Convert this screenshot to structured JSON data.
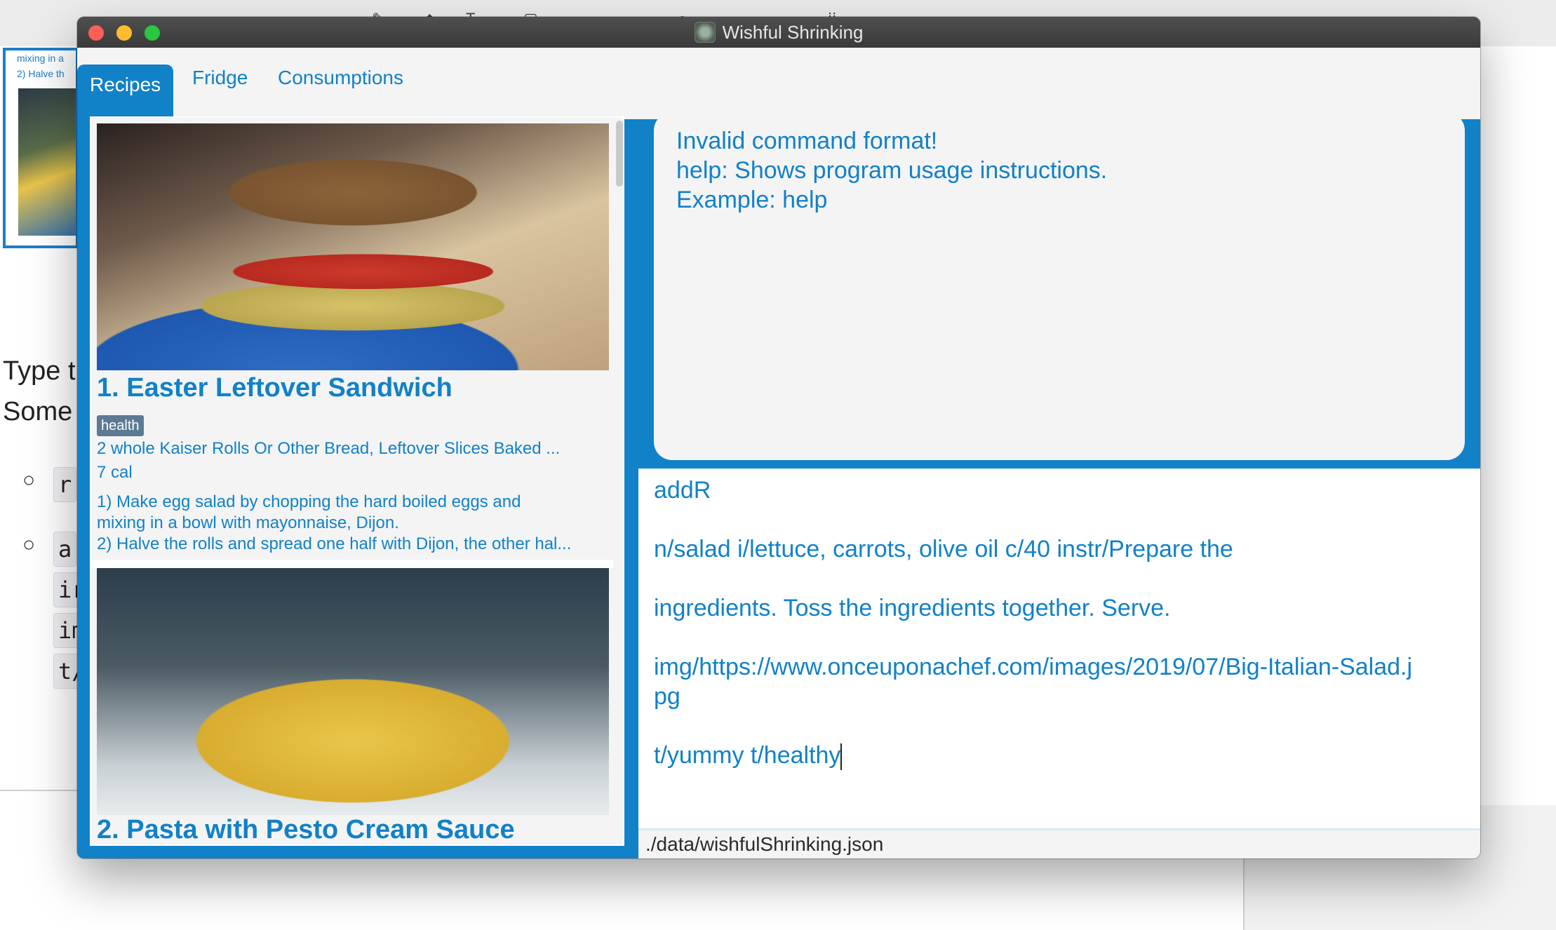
{
  "background": {
    "thumb_text": [
      "mixing in a",
      "2) Halve th"
    ],
    "text_lines": [
      "Type t",
      "Some"
    ],
    "code_snippets": [
      "r",
      "a",
      "ir",
      "im",
      "t/"
    ]
  },
  "window": {
    "title": "Wishful Shrinking"
  },
  "tabs": [
    {
      "label": "Recipes",
      "active": true
    },
    {
      "label": "Fridge",
      "active": false
    },
    {
      "label": "Consumptions",
      "active": false
    }
  ],
  "recipes": [
    {
      "title": "1.  Easter Leftover Sandwich",
      "tag": "health",
      "ingredients": "2 whole Kaiser Rolls Or Other Bread, Leftover Slices Baked ...",
      "calories": "7 cal",
      "instructions": [
        "1) Make egg salad by chopping the hard boiled eggs and",
        "mixing in a bowl with mayonnaise, Dijon.",
        "2) Halve the rolls and spread one half with Dijon, the other hal..."
      ]
    },
    {
      "title": "2.  Pasta with Pesto Cream Sauce"
    }
  ],
  "result": {
    "lines": [
      "Invalid command format!",
      "help: Shows program usage instructions.",
      "Example: help"
    ]
  },
  "command": {
    "lines": [
      "addR",
      "n/salad i/lettuce, carrots, olive oil c/40 instr/Prepare the",
      "ingredients. Toss the ingredients together. Serve.",
      "img/https://www.onceuponachef.com/images/2019/07/Big-Italian-Salad.j",
      "pg",
      "t/yummy t/healthy"
    ]
  },
  "status": {
    "file_path": "./data/wishfulShrinking.json"
  },
  "colors": {
    "accent": "#1181c8",
    "panel": "#f4f4f4",
    "tag": "#5d7a94"
  }
}
